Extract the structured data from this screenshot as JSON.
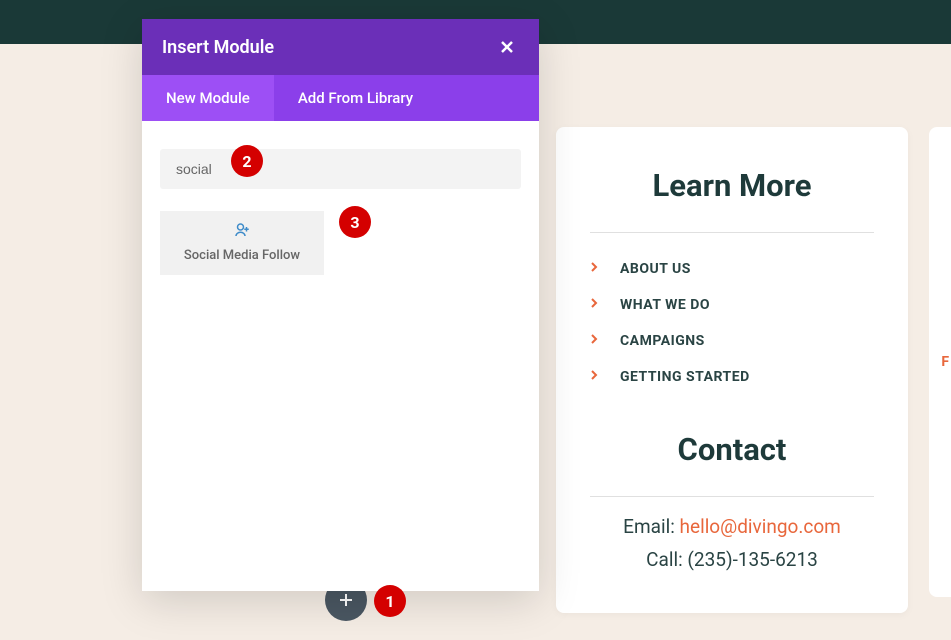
{
  "modal": {
    "title": "Insert Module",
    "tabs": {
      "new": "New Module",
      "library": "Add From Library"
    },
    "search_value": "social",
    "module_name": "Social Media Follow"
  },
  "card": {
    "learn_heading": "Learn More",
    "links": [
      "ABOUT US",
      "WHAT WE DO",
      "CAMPAIGNS",
      "GETTING STARTED"
    ],
    "contact_heading": "Contact",
    "email_label": "Email: ",
    "email": "hello@divingo.com",
    "call_label": "Call: ",
    "phone": "(235)-135-6213"
  },
  "markers": {
    "m1": "1",
    "m2": "2",
    "m3": "3"
  },
  "sliver_text": "F"
}
